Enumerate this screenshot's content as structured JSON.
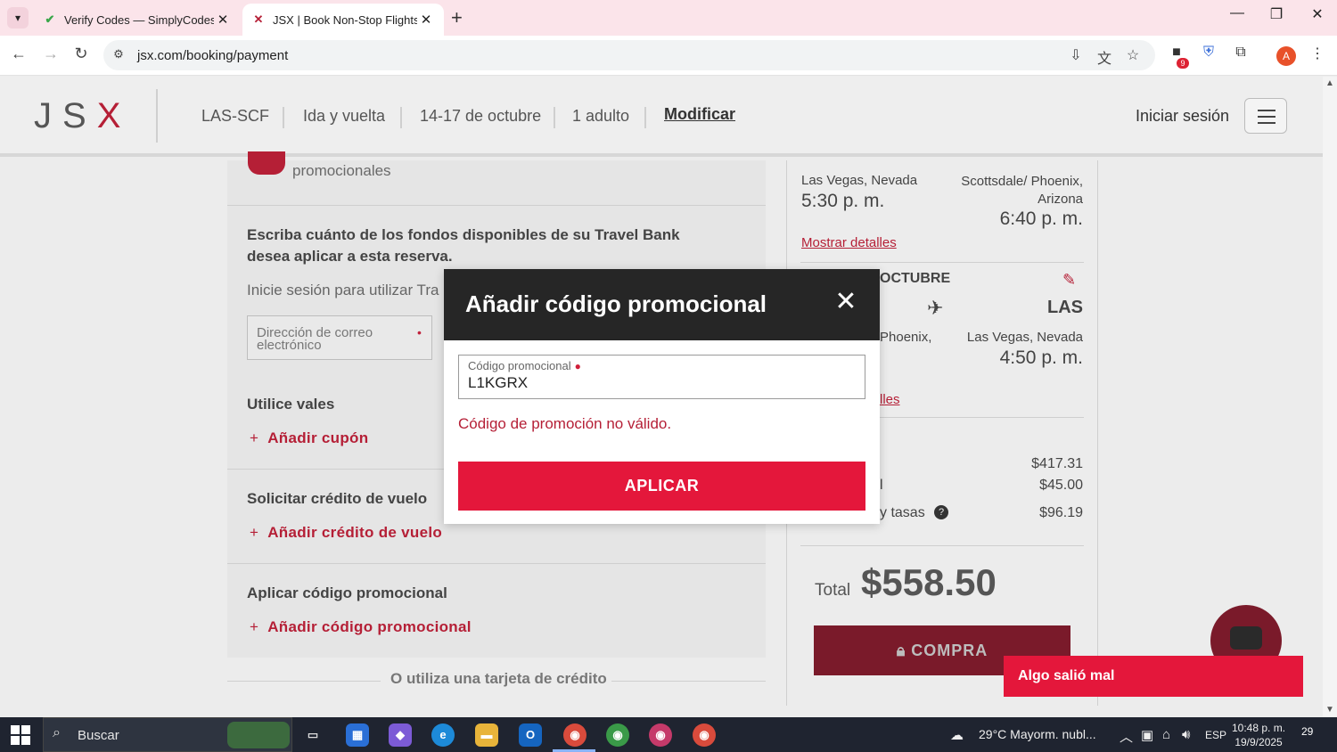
{
  "browser": {
    "tabs": [
      {
        "title": "Verify Codes — SimplyCodes",
        "favicon": "simplycodes-icon"
      },
      {
        "title": "JSX | Book Non-Stop Flights & …",
        "favicon": "jsx-x-icon"
      }
    ],
    "url": "jsx.com/booking/payment",
    "extension_badge": "9",
    "profile_initial": "A"
  },
  "header": {
    "logo": "JSX",
    "route": "LAS-SCF",
    "trip_type": "Ida y vuelta",
    "dates": "14-17 de octubre",
    "passengers": "1 adulto",
    "modify": "Modificar",
    "sign_in": "Iniciar sesión"
  },
  "payment": {
    "promo_toggle_label": "promocionales",
    "travel_bank_text": "Escriba cuánto de los fondos disponibles de su Travel Bank desea aplicar a esta reserva.",
    "sign_in_to_use": "Inicie sesión para utilizar Tra",
    "email_placeholder": "Dirección de correo electrónico",
    "vouchers_title": "Utilice vales",
    "add_coupon": "Añadir cupón",
    "flight_credit_title": "Solicitar crédito de vuelo",
    "add_flight_credit": "Añadir crédito de vuelo",
    "promo_title": "Aplicar código promocional",
    "add_promo": "Añadir código promocional",
    "or_card": "O utiliza una tarjeta de crédito"
  },
  "itinerary": {
    "out_from_city": "Las Vegas, Nevada",
    "out_from_time": "5:30 p. m.",
    "out_to_city": "Scottsdale/ Phoenix, Arizona",
    "out_to_time": "6:40 p. m.",
    "show_details": "Mostrar detalles",
    "return_header": "OCTUBRE",
    "return_dest_code": "LAS",
    "return_from_partial": "Phoenix,",
    "return_to_city": "Las Vegas, Nevada",
    "return_to_time": "4:50 p. m.",
    "return_details_partial": "lles",
    "fare": "$417.31",
    "fee_partial": "l",
    "fee": "$45.00",
    "taxes_label_partial": "y tasas",
    "taxes": "$96.19",
    "total_label": "Total",
    "total": "$558.50",
    "buy": "COMPRA"
  },
  "modal": {
    "title": "Añadir código promocional",
    "field_label": "Código promocional",
    "field_value": "L1KGRX",
    "error": "Código de promoción no válido.",
    "apply": "APLICAR"
  },
  "toast": "Algo salió mal",
  "taskbar": {
    "search": "Buscar",
    "weather": "29°C  Mayorm. nubl...",
    "lang": "ESP",
    "time": "10:48 p. m.",
    "date": "19/9/2025",
    "notifications": "29"
  },
  "colors": {
    "brand_red": "#e4173b",
    "dark_header": "#262626",
    "error_text": "#b51f36"
  }
}
